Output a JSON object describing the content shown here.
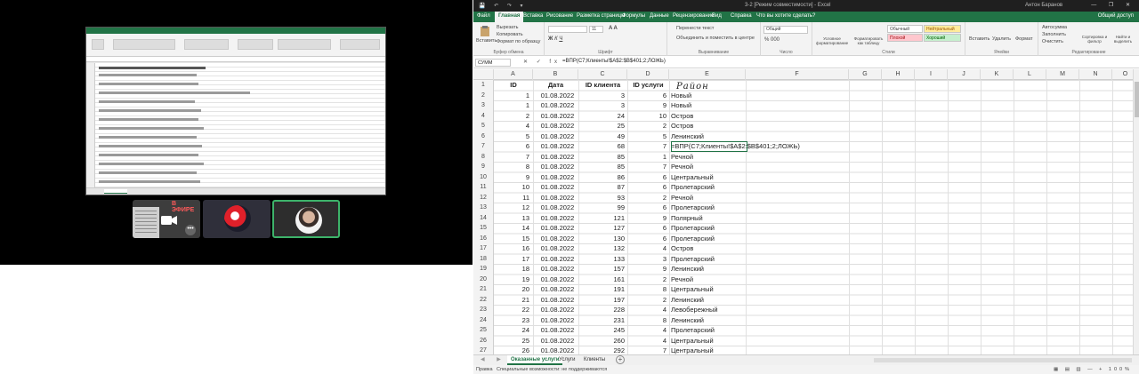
{
  "conference": {
    "record_badge": "В ЭФИРЕ",
    "more_label": "•••"
  },
  "excel": {
    "title": "3-2 [Режим совместимости] - Excel",
    "user": "Антон Баранов",
    "window_controls": "—  ❐  ✕",
    "quick_access": "💾 ↶ ↷ ▾",
    "ribbon_tabs": [
      "Файл",
      "Главная",
      "Вставка",
      "Рисование",
      "Разметка страницы",
      "Формулы",
      "Данные",
      "Рецензирование",
      "Вид",
      "Справка",
      "Что вы хотите сделать?"
    ],
    "share": "Общий доступ",
    "ribbon": {
      "paste": "Вставить",
      "cut": "Вырезать",
      "copy": "Копировать",
      "format_painter": "Формат по образцу",
      "clipboard": "Буфер обмена",
      "font": "Шрифт",
      "font_size": "11",
      "wrap_text": "Перенести текст",
      "merge_center": "Объединить и поместить в центре",
      "alignment": "Выравнивание",
      "number_format": "Общий",
      "number": "Число",
      "conditional": "Условное форматирование",
      "format_table": "Форматировать как таблицу",
      "styles_label": "Стили",
      "style_normal": "Обычный",
      "style_neutral": "Нейтральный",
      "style_bad": "Плохой",
      "style_good": "Хороший",
      "insert": "Вставить",
      "delete": "Удалить",
      "format": "Формат",
      "cells": "Ячейки",
      "autosum": "Автосумма",
      "fill": "Заполнить",
      "clear": "Очистить",
      "sort_filter": "Сортировка и фильтр",
      "find_select": "Найти и выделить",
      "editing": "Редактирование"
    },
    "name_box": "СУММ",
    "formula_symbols": "✕ ✓ fx",
    "formula": "=ВПР(C7;Клиенты!$A$2:$B$401;2;ЛОЖЬ)",
    "columns": [
      "A",
      "B",
      "C",
      "D",
      "E",
      "F",
      "G",
      "H",
      "I",
      "J",
      "K",
      "L",
      "M",
      "N",
      "O"
    ],
    "headers": {
      "id": "ID",
      "date": "Дата",
      "client_id": "ID клиента",
      "service_id": "ID услуги",
      "handwritten": "Район"
    },
    "rows": [
      {
        "n": "2",
        "id": "1",
        "date": "01.08.2022",
        "client": "3",
        "service": "6",
        "district": "Новый"
      },
      {
        "n": "3",
        "id": "1",
        "date": "01.08.2022",
        "client": "3",
        "service": "9",
        "district": "Новый"
      },
      {
        "n": "4",
        "id": "2",
        "date": "01.08.2022",
        "client": "24",
        "service": "10",
        "district": "Остров"
      },
      {
        "n": "5",
        "id": "4",
        "date": "01.08.2022",
        "client": "25",
        "service": "2",
        "district": "Остров"
      },
      {
        "n": "6",
        "id": "5",
        "date": "01.08.2022",
        "client": "49",
        "service": "5",
        "district": "Ленинский"
      },
      {
        "n": "7",
        "id": "6",
        "date": "01.08.2022",
        "client": "68",
        "service": "7",
        "district": "=ВПР(C7;Клиенты!$A$2:$B$401;2;ЛОЖЬ)"
      },
      {
        "n": "8",
        "id": "7",
        "date": "01.08.2022",
        "client": "85",
        "service": "1",
        "district": "Речной"
      },
      {
        "n": "9",
        "id": "8",
        "date": "01.08.2022",
        "client": "85",
        "service": "7",
        "district": "Речной"
      },
      {
        "n": "10",
        "id": "9",
        "date": "01.08.2022",
        "client": "86",
        "service": "6",
        "district": "Центральный"
      },
      {
        "n": "11",
        "id": "10",
        "date": "01.08.2022",
        "client": "87",
        "service": "6",
        "district": "Пролетарский"
      },
      {
        "n": "12",
        "id": "11",
        "date": "01.08.2022",
        "client": "93",
        "service": "2",
        "district": "Речной"
      },
      {
        "n": "13",
        "id": "12",
        "date": "01.08.2022",
        "client": "99",
        "service": "6",
        "district": "Пролетарский"
      },
      {
        "n": "14",
        "id": "13",
        "date": "01.08.2022",
        "client": "121",
        "service": "9",
        "district": "Полярный"
      },
      {
        "n": "15",
        "id": "14",
        "date": "01.08.2022",
        "client": "127",
        "service": "6",
        "district": "Пролетарский"
      },
      {
        "n": "16",
        "id": "15",
        "date": "01.08.2022",
        "client": "130",
        "service": "6",
        "district": "Пролетарский"
      },
      {
        "n": "17",
        "id": "16",
        "date": "01.08.2022",
        "client": "132",
        "service": "4",
        "district": "Остров"
      },
      {
        "n": "18",
        "id": "17",
        "date": "01.08.2022",
        "client": "133",
        "service": "3",
        "district": "Пролетарский"
      },
      {
        "n": "19",
        "id": "18",
        "date": "01.08.2022",
        "client": "157",
        "service": "9",
        "district": "Ленинский"
      },
      {
        "n": "20",
        "id": "19",
        "date": "01.08.2022",
        "client": "161",
        "service": "2",
        "district": "Речной"
      },
      {
        "n": "21",
        "id": "20",
        "date": "01.08.2022",
        "client": "191",
        "service": "8",
        "district": "Центральный"
      },
      {
        "n": "22",
        "id": "21",
        "date": "01.08.2022",
        "client": "197",
        "service": "2",
        "district": "Ленинский"
      },
      {
        "n": "23",
        "id": "22",
        "date": "01.08.2022",
        "client": "228",
        "service": "4",
        "district": "Левобережный"
      },
      {
        "n": "24",
        "id": "23",
        "date": "01.08.2022",
        "client": "231",
        "service": "8",
        "district": "Ленинский"
      },
      {
        "n": "25",
        "id": "24",
        "date": "01.08.2022",
        "client": "245",
        "service": "4",
        "district": "Пролетарский"
      },
      {
        "n": "26",
        "id": "25",
        "date": "01.08.2022",
        "client": "260",
        "service": "4",
        "district": "Центральный"
      },
      {
        "n": "27",
        "id": "26",
        "date": "01.08.2022",
        "client": "292",
        "service": "7",
        "district": "Центральный"
      }
    ],
    "sheet_tabs": [
      "Оказанные услуги",
      "Услуги",
      "Клиенты"
    ],
    "status_left": "Правка",
    "status_accessibility": "Специальные возможности: не поддерживаются",
    "status_right": "▦ ▤ ▥  —  +  100%"
  }
}
